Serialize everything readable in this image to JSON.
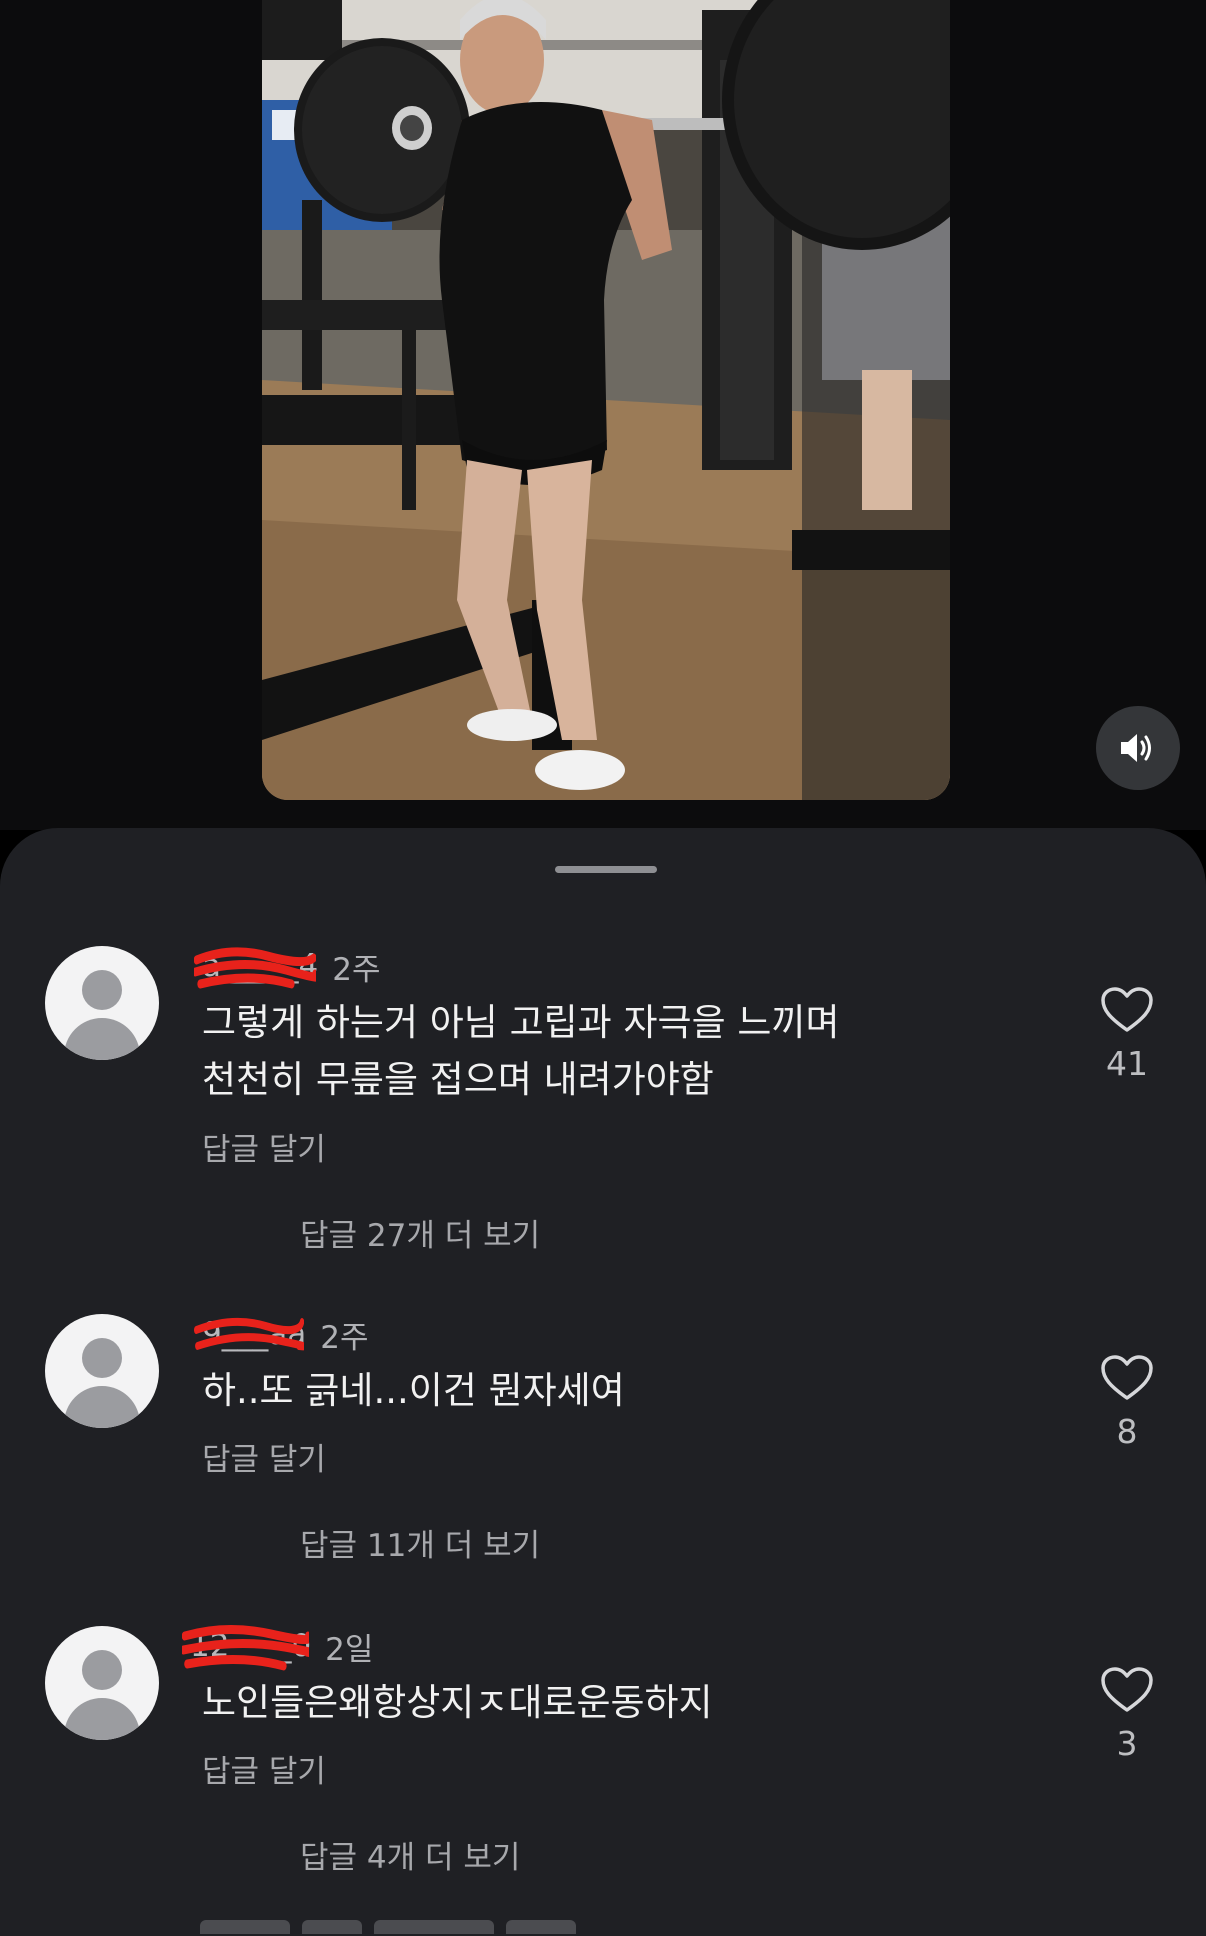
{
  "video": {
    "sound_icon": "speaker-icon"
  },
  "comments": [
    {
      "username": "a_____4",
      "time": "2주",
      "text_lines": [
        "그렇게 하는거 아님 고립과 자극을 느끼며",
        "천천히 무릎을 접으며 내려가야함"
      ],
      "reply_label": "답글 달기",
      "more_replies": "답글 27개 더 보기",
      "likes": "41"
    },
    {
      "username": "9___aa",
      "time": "2주",
      "text_lines": [
        "하..또 긁네...이건 뭔자세여"
      ],
      "reply_label": "답글 달기",
      "more_replies": "답글 11개 더 보기",
      "likes": "8"
    },
    {
      "username": "12____0",
      "time": "2일",
      "text_lines": [
        "노인들은왜항상지ㅈ대로운동하지"
      ],
      "reply_label": "답글 달기",
      "more_replies": "답글 4개 더 보기",
      "likes": "3"
    }
  ],
  "colors": {
    "sheet_background": "#1f2024",
    "page_background": "#000000",
    "redaction": "#e8221b"
  }
}
